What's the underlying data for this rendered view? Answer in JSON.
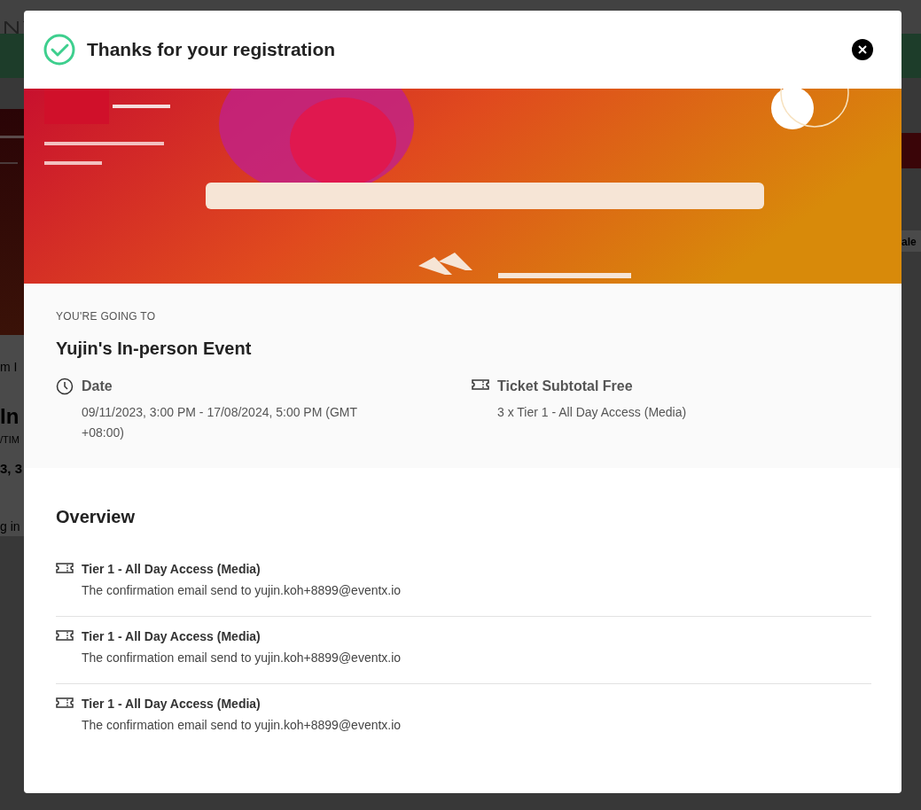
{
  "background_page": {
    "fragments_left": [
      "m I",
      "In",
      "/TIM",
      "3, 3",
      "g in"
    ],
    "fragments_right": [
      "ale"
    ]
  },
  "dialog": {
    "title": "Thanks for your registration",
    "event": {
      "eyebrow": "YOU'RE GOING TO",
      "name": "Yujin's In-person Event",
      "details": [
        {
          "kind": "date",
          "heading": "Date",
          "text": "09/11/2023, 3:00 PM - 17/08/2024, 5:00 PM (GMT +08:00)"
        },
        {
          "kind": "ticket",
          "heading": "Ticket Subtotal Free",
          "text": "3 x Tier 1 - All Day Access (Media)"
        }
      ]
    },
    "overview": {
      "heading": "Overview",
      "tickets": [
        {
          "name": "Tier 1 - All Day Access (Media)",
          "note": "The confirmation email send to yujin.koh+8899@eventx.io"
        },
        {
          "name": "Tier 1 - All Day Access (Media)",
          "note": "The confirmation email send to yujin.koh+8899@eventx.io"
        },
        {
          "name": "Tier 1 - All Day Access (Media)",
          "note": "The confirmation email send to yujin.koh+8899@eventx.io"
        }
      ]
    }
  }
}
